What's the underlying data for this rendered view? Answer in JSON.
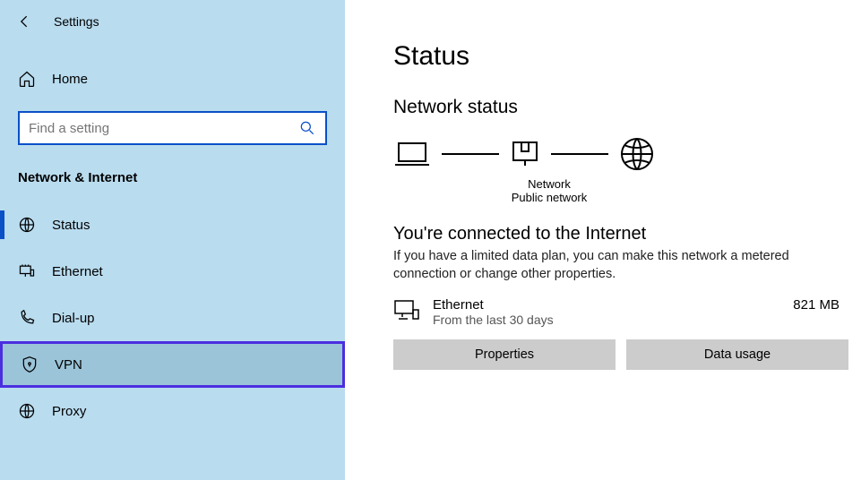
{
  "window": {
    "title": "Settings"
  },
  "sidebar": {
    "home_label": "Home",
    "search_placeholder": "Find a setting",
    "category": "Network & Internet",
    "items": [
      {
        "label": "Status"
      },
      {
        "label": "Ethernet"
      },
      {
        "label": "Dial-up"
      },
      {
        "label": "VPN"
      },
      {
        "label": "Proxy"
      }
    ]
  },
  "main": {
    "title": "Status",
    "section": "Network status",
    "diagram": {
      "mid_label": "Network",
      "mid_sub": "Public network"
    },
    "connected": {
      "title": "You're connected to the Internet",
      "desc": "If you have a limited data plan, you can make this network a metered connection or change other properties."
    },
    "connection": {
      "name": "Ethernet",
      "sub": "From the last 30 days",
      "usage": "821 MB"
    },
    "buttons": {
      "properties": "Properties",
      "data_usage": "Data usage"
    }
  }
}
